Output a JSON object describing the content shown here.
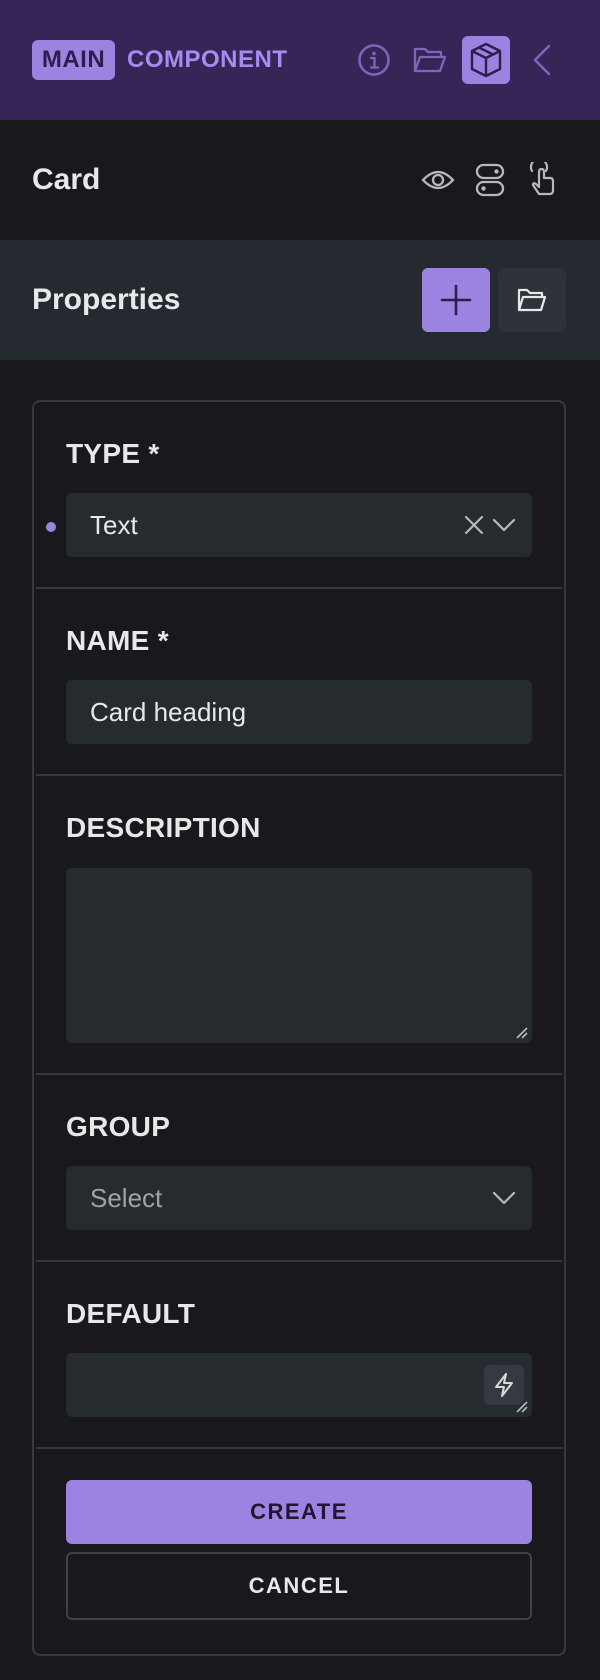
{
  "header": {
    "badge_label": "MAIN",
    "title": "COMPONENT",
    "icons": [
      "info-icon",
      "folder-icon",
      "cube-icon",
      "chevron-left-icon"
    ]
  },
  "card": {
    "title": "Card",
    "icons": [
      "eye-icon",
      "toggle-icon",
      "pointer-icon"
    ]
  },
  "properties": {
    "title": "Properties",
    "add_icon": "plus-icon",
    "open_icon": "folder-icon"
  },
  "form": {
    "type_label": "TYPE *",
    "type_value": "Text",
    "name_label": "NAME *",
    "name_value": "Card heading",
    "description_label": "DESCRIPTION",
    "description_value": "",
    "group_label": "GROUP",
    "group_placeholder": "Select",
    "default_label": "DEFAULT",
    "default_value": "",
    "create_label": "CREATE",
    "cancel_label": "CANCEL"
  },
  "colors": {
    "accent": "#9c83e2",
    "header_bg": "#352657",
    "panel_bg": "#19191d",
    "section_bg": "#242a2f",
    "input_bg": "#262b30"
  }
}
